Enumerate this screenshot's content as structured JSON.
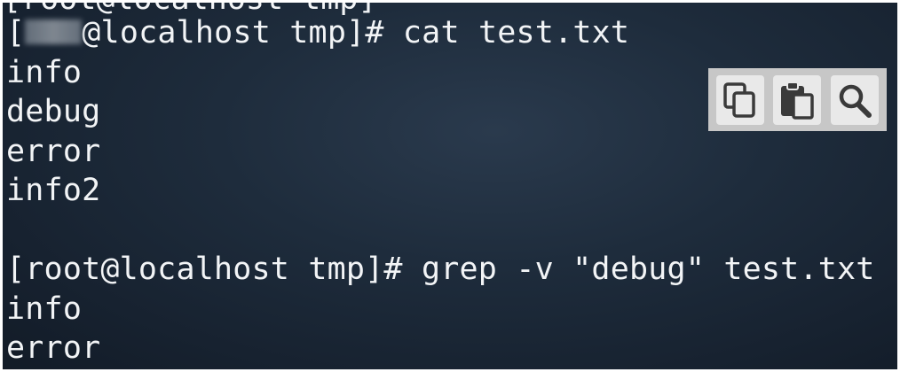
{
  "terminal": {
    "cutoff_top": "[root@localhost tmp]",
    "lines": [
      {
        "prompt_open": "[",
        "prompt_rest": "@localhost tmp]# ",
        "command": "cat test.txt"
      },
      {
        "text": "info"
      },
      {
        "text": "debug"
      },
      {
        "text": "error"
      },
      {
        "text": "info2"
      },
      {
        "text": ""
      },
      {
        "prompt": "[root@localhost tmp]# ",
        "command": "grep -v \"debug\" test.txt"
      },
      {
        "text": "info"
      },
      {
        "text": "error"
      }
    ]
  },
  "toolbar": {
    "icons": [
      "copy-icon",
      "paste-icon",
      "search-icon"
    ]
  },
  "colors": {
    "terminal_bg": "#1e2c3c",
    "text": "#f2f4f6",
    "toolbar_bg": "#c7c7c7",
    "toolbar_button": "#e9e9e9",
    "icon": "#3a3a3a"
  }
}
